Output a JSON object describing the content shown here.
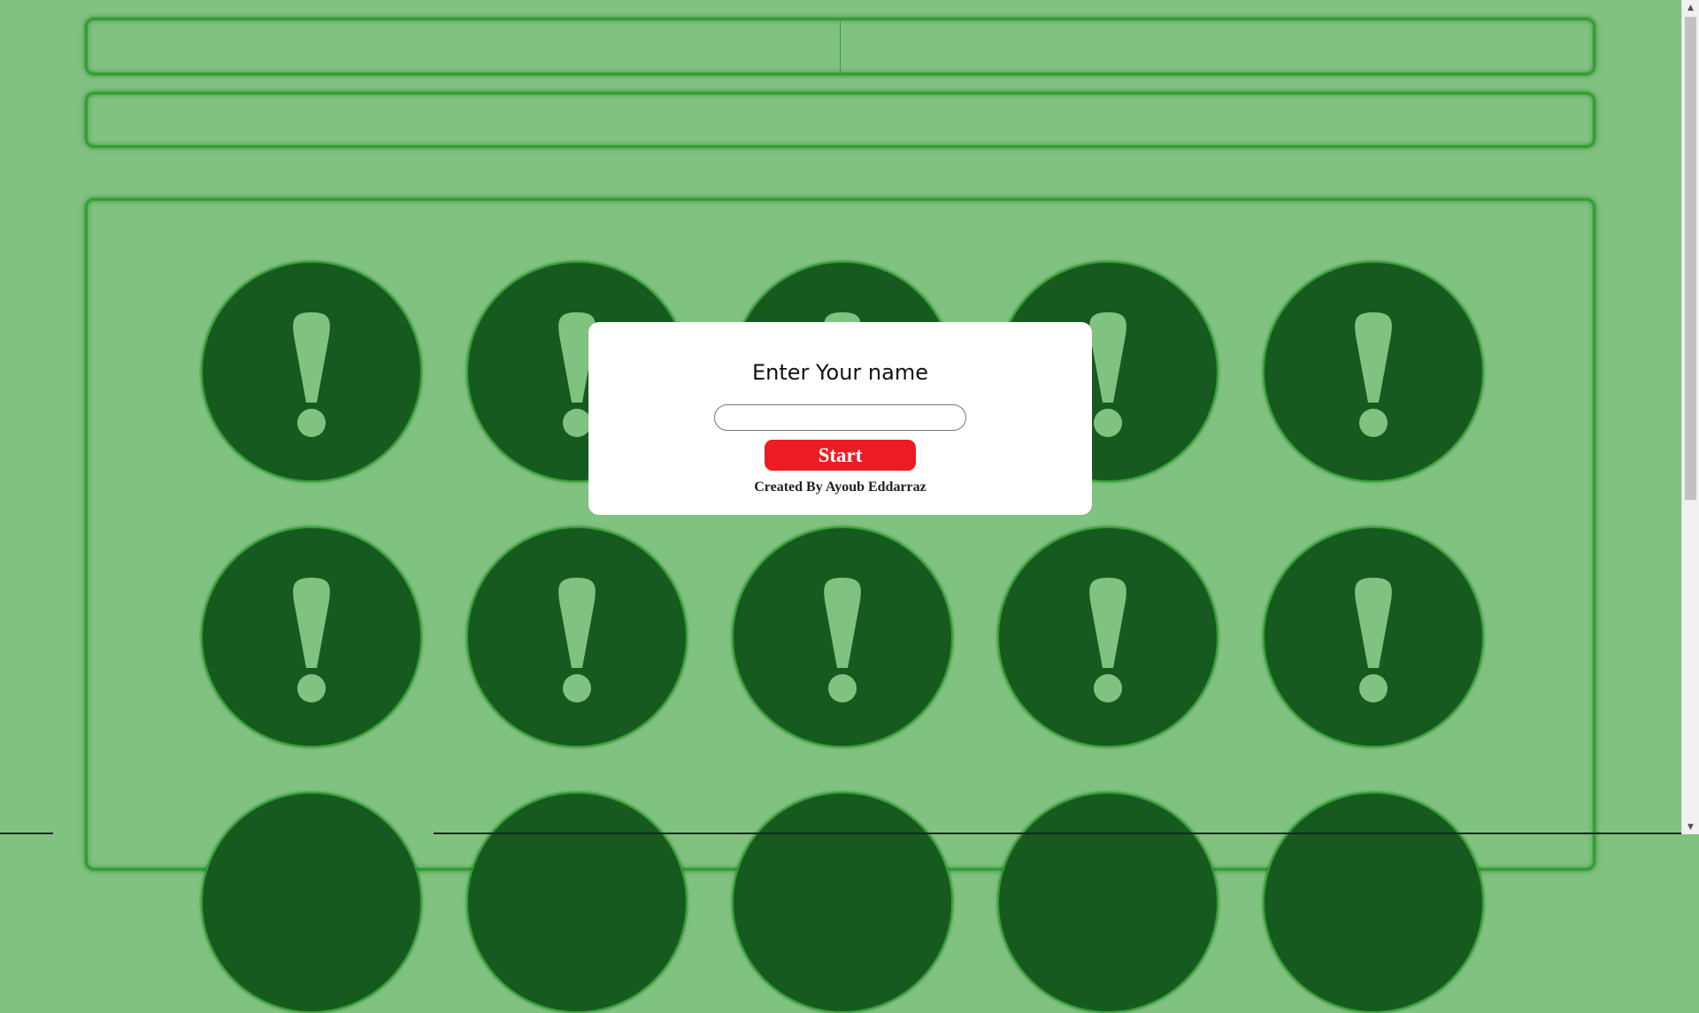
{
  "game": {
    "header": {
      "left_text": "",
      "right_text": "",
      "status_text": ""
    },
    "board": {
      "card_count_visible": 15,
      "card_face_symbol": "exclamation-icon",
      "card_color": "#175a1f",
      "card_border_color": "#33a433",
      "symbol_color": "#80c280"
    }
  },
  "modal": {
    "title": "Enter Your name",
    "name_input": {
      "value": "",
      "placeholder": ""
    },
    "start_label": "Start",
    "credit": "Created By Ayoub Eddarraz"
  },
  "colors": {
    "background": "#80c280",
    "panel_border": "#2fa02f",
    "start_button": "#ec1c24",
    "modal_background": "#ffffff"
  }
}
